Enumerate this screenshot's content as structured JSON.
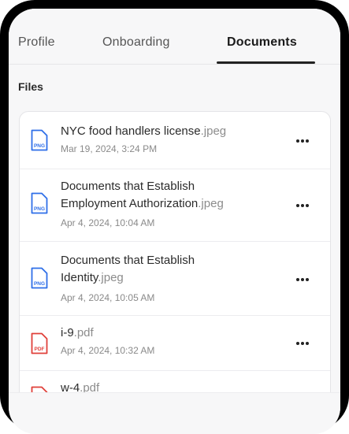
{
  "tabs": [
    {
      "label": "Profile"
    },
    {
      "label": "Onboarding"
    },
    {
      "label": "Documents"
    }
  ],
  "section_title": "Files",
  "files": [
    {
      "name_lines": [
        "NYC food handlers license"
      ],
      "ext": ".jpeg",
      "date": "Mar 19, 2024, 3:24 PM",
      "type": "PNG",
      "type_color": "#2f6fe8"
    },
    {
      "name_lines": [
        "Documents that Establish",
        "Employment Authorization"
      ],
      "ext": ".jpeg",
      "date": "Apr 4, 2024, 10:04 AM",
      "type": "PNG",
      "type_color": "#2f6fe8"
    },
    {
      "name_lines": [
        "Documents that Establish",
        "Identity"
      ],
      "ext": ".jpeg",
      "date": "Apr 4, 2024, 10:05 AM",
      "type": "PNG",
      "type_color": "#2f6fe8"
    },
    {
      "name_lines": [
        "i-9"
      ],
      "ext": ".pdf",
      "date": "Apr 4, 2024, 10:32 AM",
      "type": "PDF",
      "type_color": "#e0403a"
    },
    {
      "name_lines": [
        "w-4"
      ],
      "ext": ".pdf",
      "date": "",
      "type": "PDF",
      "type_color": "#e0403a"
    }
  ]
}
